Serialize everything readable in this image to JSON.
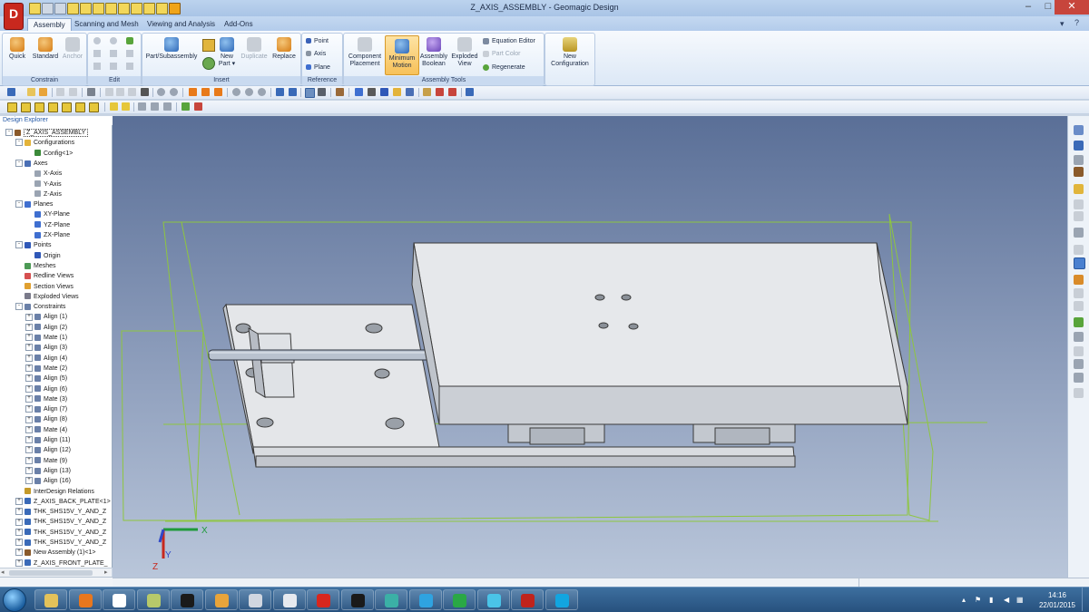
{
  "window": {
    "title": "Z_AXIS_ASSEMBLY - Geomagic Design",
    "app_logo_letter": "D",
    "minimize": "–",
    "maximize": "□",
    "close": "✕"
  },
  "ribbon": {
    "tabs": [
      {
        "label": "Assembly",
        "active": true
      },
      {
        "label": "Scanning and Mesh"
      },
      {
        "label": "Viewing and Analysis"
      },
      {
        "label": "Add-Ons"
      }
    ],
    "groups": {
      "constrain": {
        "label": "Constrain",
        "quick": "Quick",
        "standard": "Standard",
        "anchor": "Anchor"
      },
      "edit": {
        "label": "Edit"
      },
      "insert": {
        "label": "Insert",
        "part_subassembly": "Part/Subassembly",
        "new_part_line1": "New",
        "new_part_line2": "Part",
        "duplicate": "Duplicate",
        "replace": "Replace"
      },
      "reference": {
        "label": "Reference",
        "point": "Point",
        "axis": "Axis",
        "plane": "Plane"
      },
      "assembly_tools": {
        "label": "Assembly Tools",
        "component_placement_line1": "Component",
        "component_placement_line2": "Placement",
        "minimum_motion_line1": "Minimum",
        "minimum_motion_line2": "Motion",
        "assembly_boolean_line1": "Assembly",
        "assembly_boolean_line2": "Boolean",
        "exploded_view_line1": "Exploded",
        "exploded_view_line2": "View",
        "equation_editor": "Equation Editor",
        "part_color": "Part Color",
        "regenerate": "Regenerate"
      },
      "configuration": {
        "new_configuration_line1": "New",
        "new_configuration_line2": "Configuration"
      }
    }
  },
  "explorer": {
    "header": "Design Explorer",
    "tree": [
      {
        "label": "Z_AXIS_ASSEMBLY",
        "level": 0,
        "exp": "-",
        "icon": "#8a5a2b",
        "root": true
      },
      {
        "label": "Configurations",
        "level": 1,
        "exp": "-",
        "icon": "#e3b33a"
      },
      {
        "label": "Config<1>",
        "level": 2,
        "icon": "#3c8a3a"
      },
      {
        "label": "Axes",
        "level": 1,
        "exp": "-",
        "icon": "#4a6fb5"
      },
      {
        "label": "X-Axis",
        "level": 2,
        "icon": "#9aa4b2"
      },
      {
        "label": "Y-Axis",
        "level": 2,
        "icon": "#9aa4b2"
      },
      {
        "label": "Z-Axis",
        "level": 2,
        "icon": "#9aa4b2"
      },
      {
        "label": "Planes",
        "level": 1,
        "exp": "-",
        "icon": "#3f6fd0"
      },
      {
        "label": "XY-Plane",
        "level": 2,
        "icon": "#3f6fd0"
      },
      {
        "label": "YZ-Plane",
        "level": 2,
        "icon": "#3f6fd0"
      },
      {
        "label": "ZX-Plane",
        "level": 2,
        "icon": "#3f6fd0"
      },
      {
        "label": "Points",
        "level": 1,
        "exp": "-",
        "icon": "#2f58b8"
      },
      {
        "label": "Origin",
        "level": 2,
        "icon": "#2f58b8"
      },
      {
        "label": "Meshes",
        "level": 1,
        "icon": "#4d9a55"
      },
      {
        "label": "Redline Views",
        "level": 1,
        "icon": "#d65050"
      },
      {
        "label": "Section Views",
        "level": 1,
        "icon": "#e0a030"
      },
      {
        "label": "Exploded Views",
        "level": 1,
        "icon": "#7a7a8a"
      },
      {
        "label": "Constraints",
        "level": 1,
        "exp": "-",
        "icon": "#6a80a8"
      },
      {
        "label": "Align (1)",
        "level": 2,
        "exp": "+",
        "icon": "#6a80a8"
      },
      {
        "label": "Align (2)",
        "level": 2,
        "exp": "+",
        "icon": "#6a80a8"
      },
      {
        "label": "Mate (1)",
        "level": 2,
        "exp": "+",
        "icon": "#6a80a8"
      },
      {
        "label": "Align (3)",
        "level": 2,
        "exp": "+",
        "icon": "#6a80a8"
      },
      {
        "label": "Align (4)",
        "level": 2,
        "exp": "+",
        "icon": "#6a80a8"
      },
      {
        "label": "Mate (2)",
        "level": 2,
        "exp": "+",
        "icon": "#6a80a8"
      },
      {
        "label": "Align (5)",
        "level": 2,
        "exp": "+",
        "icon": "#6a80a8"
      },
      {
        "label": "Align (6)",
        "level": 2,
        "exp": "+",
        "icon": "#6a80a8"
      },
      {
        "label": "Mate (3)",
        "level": 2,
        "exp": "+",
        "icon": "#6a80a8"
      },
      {
        "label": "Align (7)",
        "level": 2,
        "exp": "+",
        "icon": "#6a80a8"
      },
      {
        "label": "Align (8)",
        "level": 2,
        "exp": "+",
        "icon": "#6a80a8"
      },
      {
        "label": "Mate (4)",
        "level": 2,
        "exp": "+",
        "icon": "#6a80a8"
      },
      {
        "label": "Align (11)",
        "level": 2,
        "exp": "+",
        "icon": "#6a80a8"
      },
      {
        "label": "Align (12)",
        "level": 2,
        "exp": "+",
        "icon": "#6a80a8"
      },
      {
        "label": "Mate (9)",
        "level": 2,
        "exp": "+",
        "icon": "#6a80a8"
      },
      {
        "label": "Align (13)",
        "level": 2,
        "exp": "+",
        "icon": "#6a80a8"
      },
      {
        "label": "Align (16)",
        "level": 2,
        "exp": "+",
        "icon": "#6a80a8"
      },
      {
        "label": "InterDesign Relations",
        "level": 1,
        "icon": "#c49a2a"
      },
      {
        "label": "Z_AXIS_BACK_PLATE<1>",
        "level": 1,
        "exp": "+",
        "icon": "#3a6ab8"
      },
      {
        "label": "THK_SHS15V_Y_AND_Z",
        "level": 1,
        "exp": "+",
        "icon": "#3a6ab8"
      },
      {
        "label": "THK_SHS15V_Y_AND_Z",
        "level": 1,
        "exp": "+",
        "icon": "#3a6ab8"
      },
      {
        "label": "THK_SHS15V_Y_AND_Z",
        "level": 1,
        "exp": "+",
        "icon": "#3a6ab8"
      },
      {
        "label": "THK_SHS15V_Y_AND_Z",
        "level": 1,
        "exp": "+",
        "icon": "#3a6ab8"
      },
      {
        "label": "New Assembly (1)<1>",
        "level": 1,
        "exp": "+",
        "icon": "#8a5a2b"
      },
      {
        "label": "Z_AXIS_FRONT_PLATE_",
        "level": 1,
        "exp": "+",
        "icon": "#3a6ab8"
      }
    ]
  },
  "triad": {
    "x_label": "X",
    "y_label": "Y",
    "z_label": "Z"
  },
  "taskbar": {
    "time": "14:16",
    "date": "22/01/2015",
    "apps": [
      "explorer",
      "firefox",
      "transfer",
      "file",
      "network",
      "folder",
      "messenger",
      "document",
      "redbird",
      "capture",
      "drafting",
      "qtranslate",
      "dragon",
      "switcher",
      "geomagic",
      "skype"
    ],
    "app_colors": [
      "#e3c25a",
      "#e8771e",
      "#ffffff",
      "#b7c96a",
      "#1a1a1a",
      "#e8a43a",
      "#d0d6e0",
      "#e6e9ef",
      "#d8271e",
      "#1a1a1a",
      "#3bb0a6",
      "#2fa3e0",
      "#2aa845",
      "#4ac4e8",
      "#c0231c",
      "#12a5e0"
    ]
  },
  "colors": {
    "accent": "#2458a6",
    "viewport_top": "#5a6f97",
    "viewport_bottom": "#b9c6da",
    "wireframe": "#8ec63f",
    "part_face": "#e4e6e9"
  }
}
